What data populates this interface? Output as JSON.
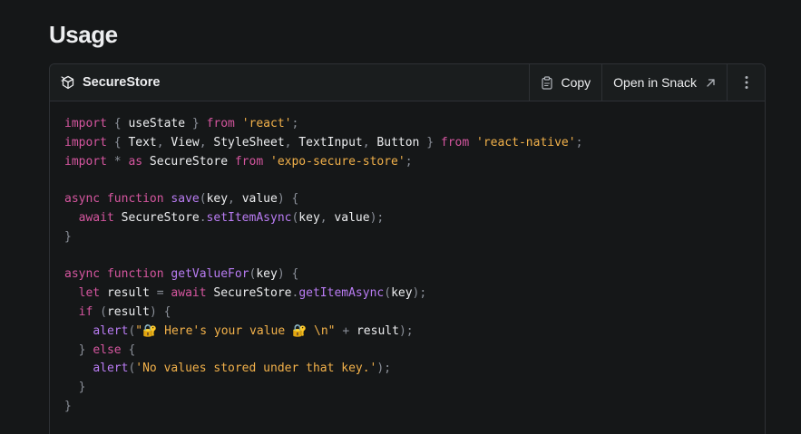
{
  "heading": "Usage",
  "file": {
    "name": "SecureStore",
    "icon": "expo-snack-cube-icon"
  },
  "actions": {
    "copy_label": "Copy",
    "snack_label": "Open in Snack",
    "more_icon": "vertical-ellipsis-icon"
  },
  "code_lines": [
    [
      [
        "kw",
        "import"
      ],
      [
        "id",
        " "
      ],
      [
        "punc",
        "{"
      ],
      [
        "id",
        " useState "
      ],
      [
        "punc",
        "}"
      ],
      [
        "id",
        " "
      ],
      [
        "kw",
        "from"
      ],
      [
        "id",
        " "
      ],
      [
        "str",
        "'react'"
      ],
      [
        "punc",
        ";"
      ]
    ],
    [
      [
        "kw",
        "import"
      ],
      [
        "id",
        " "
      ],
      [
        "punc",
        "{"
      ],
      [
        "id",
        " Text"
      ],
      [
        "punc",
        ","
      ],
      [
        "id",
        " View"
      ],
      [
        "punc",
        ","
      ],
      [
        "id",
        " StyleSheet"
      ],
      [
        "punc",
        ","
      ],
      [
        "id",
        " TextInput"
      ],
      [
        "punc",
        ","
      ],
      [
        "id",
        " Button "
      ],
      [
        "punc",
        "}"
      ],
      [
        "id",
        " "
      ],
      [
        "kw",
        "from"
      ],
      [
        "id",
        " "
      ],
      [
        "str",
        "'react-native'"
      ],
      [
        "punc",
        ";"
      ]
    ],
    [
      [
        "kw",
        "import"
      ],
      [
        "id",
        " "
      ],
      [
        "punc",
        "*"
      ],
      [
        "id",
        " "
      ],
      [
        "kw",
        "as"
      ],
      [
        "id",
        " SecureStore "
      ],
      [
        "kw",
        "from"
      ],
      [
        "id",
        " "
      ],
      [
        "str",
        "'expo-secure-store'"
      ],
      [
        "punc",
        ";"
      ]
    ],
    [],
    [
      [
        "kw",
        "async"
      ],
      [
        "id",
        " "
      ],
      [
        "kw",
        "function"
      ],
      [
        "id",
        " "
      ],
      [
        "fn",
        "save"
      ],
      [
        "punc",
        "("
      ],
      [
        "id",
        "key"
      ],
      [
        "punc",
        ","
      ],
      [
        "id",
        " value"
      ],
      [
        "punc",
        ")"
      ],
      [
        "id",
        " "
      ],
      [
        "punc",
        "{"
      ]
    ],
    [
      [
        "id",
        "  "
      ],
      [
        "kw",
        "await"
      ],
      [
        "id",
        " SecureStore"
      ],
      [
        "punc",
        "."
      ],
      [
        "fn",
        "setItemAsync"
      ],
      [
        "punc",
        "("
      ],
      [
        "id",
        "key"
      ],
      [
        "punc",
        ","
      ],
      [
        "id",
        " value"
      ],
      [
        "punc",
        ");"
      ]
    ],
    [
      [
        "punc",
        "}"
      ]
    ],
    [],
    [
      [
        "kw",
        "async"
      ],
      [
        "id",
        " "
      ],
      [
        "kw",
        "function"
      ],
      [
        "id",
        " "
      ],
      [
        "fn",
        "getValueFor"
      ],
      [
        "punc",
        "("
      ],
      [
        "id",
        "key"
      ],
      [
        "punc",
        ")"
      ],
      [
        "id",
        " "
      ],
      [
        "punc",
        "{"
      ]
    ],
    [
      [
        "id",
        "  "
      ],
      [
        "kw",
        "let"
      ],
      [
        "id",
        " result "
      ],
      [
        "punc",
        "="
      ],
      [
        "id",
        " "
      ],
      [
        "kw",
        "await"
      ],
      [
        "id",
        " SecureStore"
      ],
      [
        "punc",
        "."
      ],
      [
        "fn",
        "getItemAsync"
      ],
      [
        "punc",
        "("
      ],
      [
        "id",
        "key"
      ],
      [
        "punc",
        ");"
      ]
    ],
    [
      [
        "id",
        "  "
      ],
      [
        "kw",
        "if"
      ],
      [
        "id",
        " "
      ],
      [
        "punc",
        "("
      ],
      [
        "id",
        "result"
      ],
      [
        "punc",
        ")"
      ],
      [
        "id",
        " "
      ],
      [
        "punc",
        "{"
      ]
    ],
    [
      [
        "id",
        "    "
      ],
      [
        "fn",
        "alert"
      ],
      [
        "punc",
        "("
      ],
      [
        "str",
        "\"🔐 Here's your value 🔐 \\n\""
      ],
      [
        "id",
        " "
      ],
      [
        "punc",
        "+"
      ],
      [
        "id",
        " result"
      ],
      [
        "punc",
        ");"
      ]
    ],
    [
      [
        "id",
        "  "
      ],
      [
        "punc",
        "}"
      ],
      [
        "id",
        " "
      ],
      [
        "kw",
        "else"
      ],
      [
        "id",
        " "
      ],
      [
        "punc",
        "{"
      ]
    ],
    [
      [
        "id",
        "    "
      ],
      [
        "fn",
        "alert"
      ],
      [
        "punc",
        "("
      ],
      [
        "str",
        "'No values stored under that key.'"
      ],
      [
        "punc",
        ");"
      ]
    ],
    [
      [
        "id",
        "  "
      ],
      [
        "punc",
        "}"
      ]
    ],
    [
      [
        "punc",
        "}"
      ]
    ]
  ]
}
